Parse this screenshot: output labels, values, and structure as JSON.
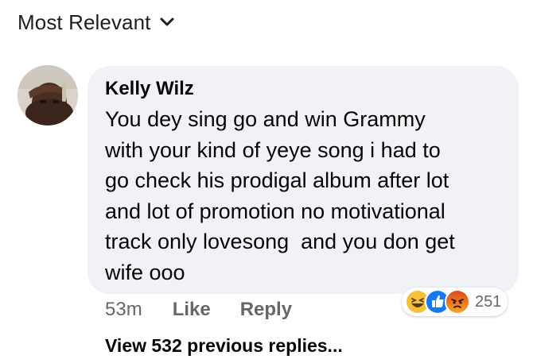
{
  "sort": {
    "label": "Most Relevant",
    "icon": "chevron-down-icon"
  },
  "comment": {
    "author": "Kelly Wilz",
    "text": "You dey sing go and win Grammy\nwith your kind of yeye song i had to\ngo check his prodigal album after lot\nand lot of promotion no motivational\ntrack only lovesong  and you don get\nwife ooo",
    "timestamp": "53m",
    "like_label": "Like",
    "reply_label": "Reply",
    "reactions": {
      "icons": [
        "haha-icon",
        "like-icon",
        "angry-icon"
      ],
      "count": "251"
    }
  },
  "replies": {
    "view_label": "View 532 previous replies..."
  },
  "colors": {
    "bubble": "#f0f2f5",
    "secondary_text": "#65676b",
    "like_blue": "#1877f2",
    "haha_yellow": "#f7c03b",
    "angry_orange": "#e9710f"
  }
}
